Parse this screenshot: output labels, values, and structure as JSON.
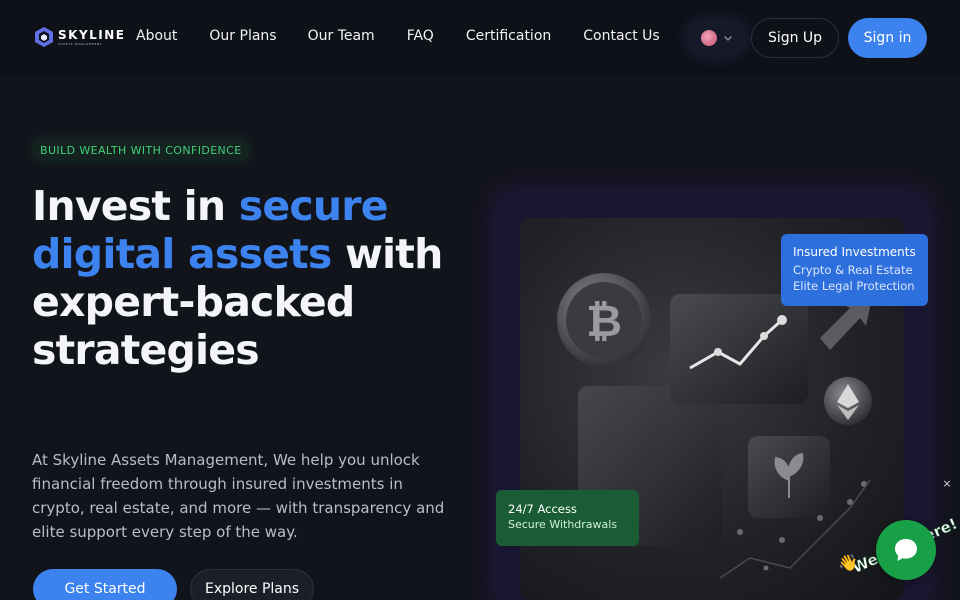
{
  "brand": {
    "name": "SKYLINE",
    "sub": "ASSETS MANAGEMENT",
    "colors": {
      "accent": "#3d83f0",
      "green": "#44cf7a",
      "background": "#12141c"
    }
  },
  "nav": {
    "items": [
      "About",
      "Our Plans",
      "Our Team",
      "FAQ",
      "Certification",
      "Contact Us"
    ],
    "language_icon": "us-flag-icon",
    "signup_label": "Sign Up",
    "signin_label": "Sign in"
  },
  "hero": {
    "tagline": "BUILD WEALTH WITH CONFIDENCE",
    "headline_part1": "Invest in ",
    "headline_highlight": "secure digital assets",
    "headline_part2": " with expert-backed strategies",
    "description": "At Skyline Assets Management, We help you unlock financial freedom through insured investments in crypto, real estate, and more — with transparency and elite support every step of the way.",
    "cta_primary": "Get Started",
    "cta_secondary": "Explore Plans"
  },
  "visual": {
    "insured": {
      "title": "Insured Investments",
      "line1": "Crypto & Real Estate",
      "line2": "Elite Legal Protection"
    },
    "access": {
      "title": "24/7 Access",
      "line1": "Secure Withdrawals"
    },
    "icons": [
      "bitcoin-icon",
      "chart-up-icon",
      "ethereum-icon",
      "plant-icon",
      "arrow-up-icon"
    ]
  },
  "chat": {
    "label": "We Are Here!",
    "icon": "chat-bubble-icon",
    "close": "×"
  }
}
